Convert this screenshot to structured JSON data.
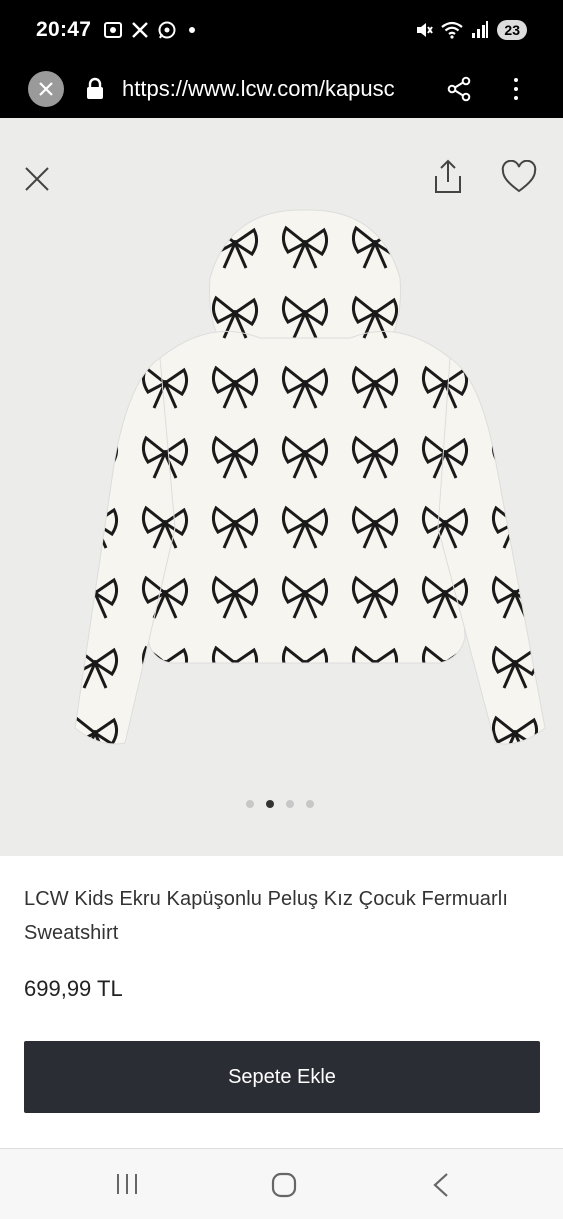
{
  "status": {
    "time": "20:47",
    "battery": "23",
    "left_icons": [
      "screenshot-icon",
      "x-logo-icon",
      "whatsapp-icon"
    ],
    "right_icons": [
      "mute-icon",
      "wifi-icon",
      "signal-icon"
    ]
  },
  "browser": {
    "url": "https://www.lcw.com/kapusc"
  },
  "product": {
    "title": "LCW Kids Ekru Kapüşonlu Peluş Kız Çocuk Fermuarlı Sweatshirt",
    "price": "699,99 TL",
    "cart_label": "Sepete Ekle",
    "image_count": 4,
    "active_image": 1
  },
  "colors": {
    "button_bg": "#2a2d33",
    "image_bg": "#ececea"
  }
}
